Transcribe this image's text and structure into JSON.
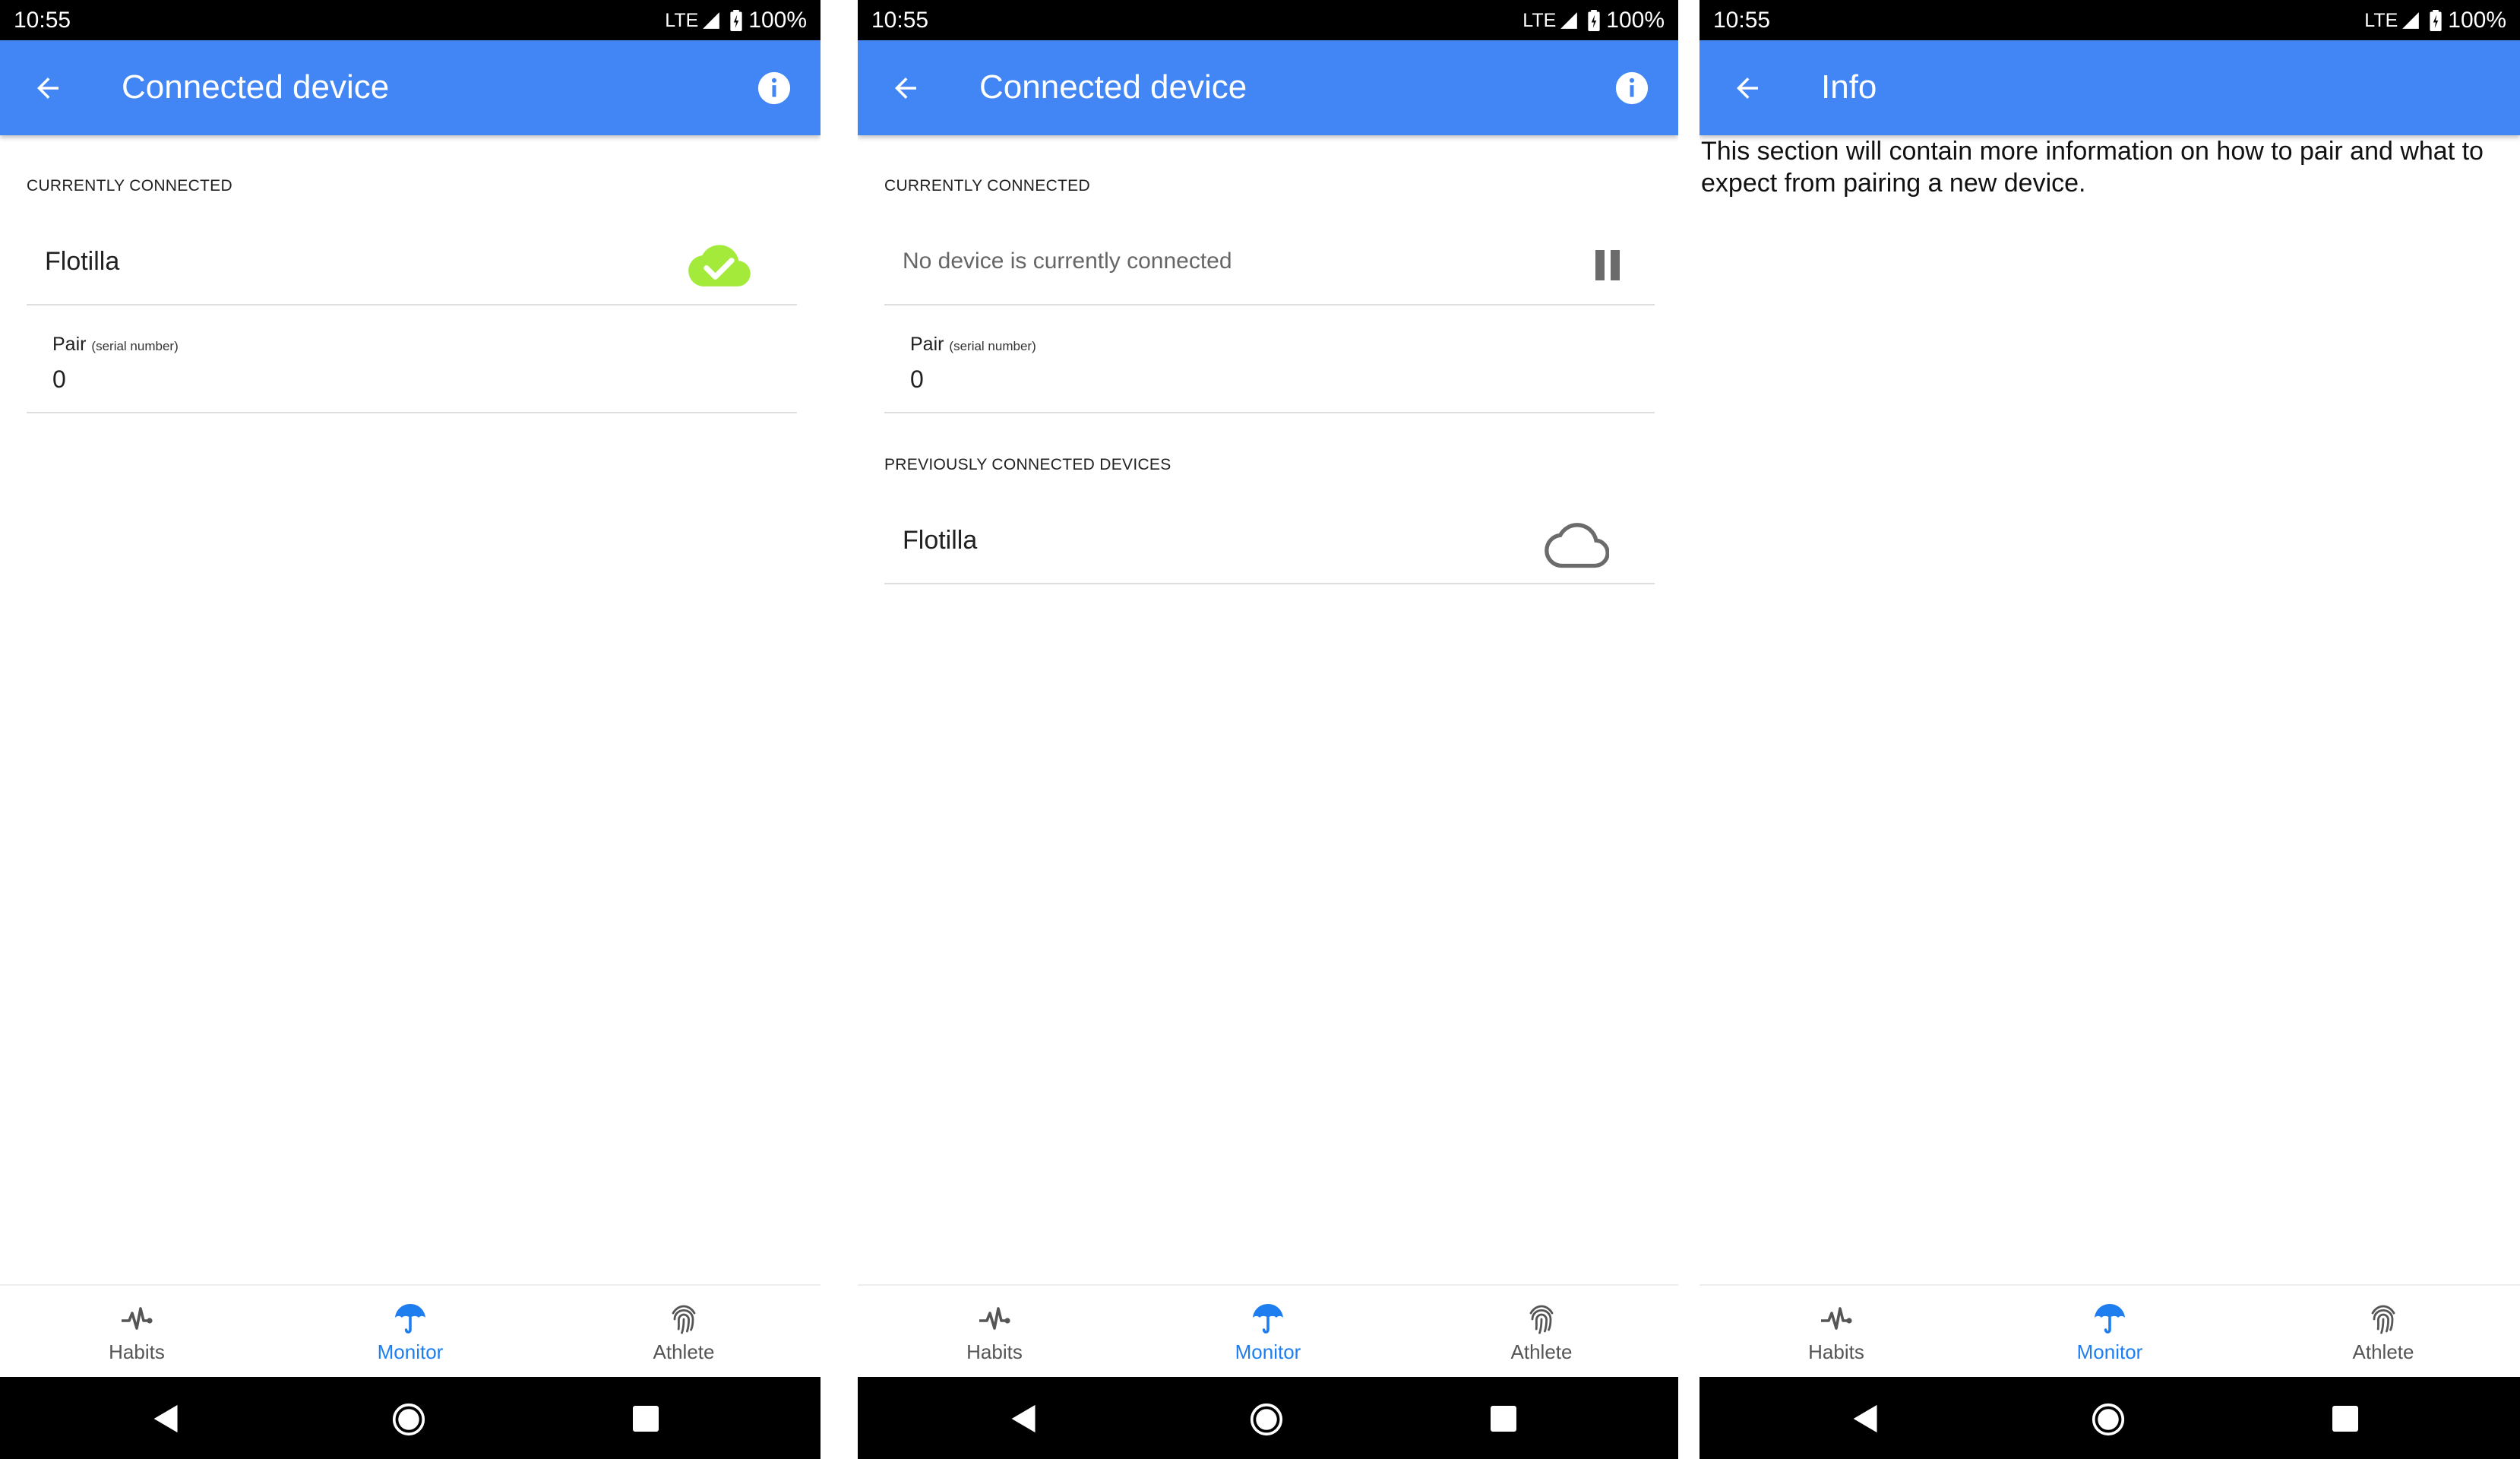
{
  "screens": [
    {
      "status": {
        "time": "10:55",
        "network": "LTE",
        "battery": "100%"
      },
      "appbar": {
        "title": "Connected device",
        "back_icon": "arrow-back-icon",
        "info_icon": "info-icon"
      },
      "currently_connected": {
        "header": "CURRENTLY CONNECTED",
        "device_name": "Flotilla",
        "status_icon": "cloud-check-icon",
        "status_color": "#a3ea3b"
      },
      "pair": {
        "label": "Pair",
        "hint": "(serial number)",
        "value": "0"
      },
      "nav": {
        "items": [
          {
            "label": "Habits",
            "icon": "heartbeat-icon"
          },
          {
            "label": "Monitor",
            "icon": "umbrella-icon"
          },
          {
            "label": "Athlete",
            "icon": "fingerprint-icon"
          }
        ],
        "active": "Monitor"
      }
    },
    {
      "status": {
        "time": "10:55",
        "network": "LTE",
        "battery": "100%"
      },
      "appbar": {
        "title": "Connected device",
        "back_icon": "arrow-back-icon",
        "info_icon": "info-icon"
      },
      "currently_connected": {
        "header": "CURRENTLY CONNECTED",
        "empty_text": "No device is currently connected",
        "status_icon": "pause-icon"
      },
      "pair": {
        "label": "Pair",
        "hint": "(serial number)",
        "value": "0"
      },
      "previously_connected": {
        "header": "PREVIOUSLY CONNECTED DEVICES",
        "devices": [
          {
            "name": "Flotilla",
            "icon": "cloud-outline-icon"
          }
        ]
      },
      "nav": {
        "items": [
          {
            "label": "Habits",
            "icon": "heartbeat-icon"
          },
          {
            "label": "Monitor",
            "icon": "umbrella-icon"
          },
          {
            "label": "Athlete",
            "icon": "fingerprint-icon"
          }
        ],
        "active": "Monitor"
      }
    },
    {
      "status": {
        "time": "10:55",
        "network": "LTE",
        "battery": "100%"
      },
      "appbar": {
        "title": "Info",
        "back_icon": "arrow-back-icon"
      },
      "body_text": "This section will contain more information on how to pair and what to expect from pairing a new device.",
      "nav": {
        "items": [
          {
            "label": "Habits",
            "icon": "heartbeat-icon"
          },
          {
            "label": "Monitor",
            "icon": "umbrella-icon"
          },
          {
            "label": "Athlete",
            "icon": "fingerprint-icon"
          }
        ],
        "active": "Monitor"
      }
    }
  ],
  "colors": {
    "appbar": "#4285f4",
    "active_tab": "#1e7ef0",
    "connected_cloud": "#a3ea3b"
  }
}
